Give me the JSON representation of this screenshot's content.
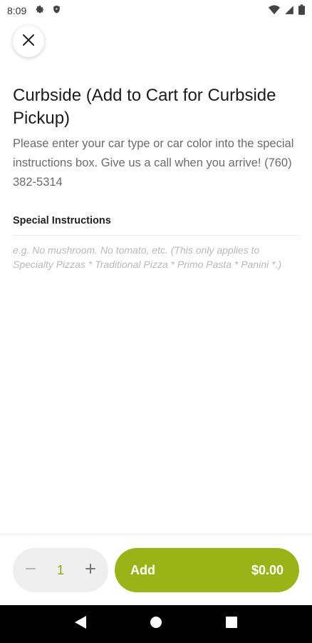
{
  "status_bar": {
    "time": "8:09",
    "icons": [
      "gear-icon",
      "shield-icon",
      "wifi-icon",
      "signal-icon",
      "battery-icon"
    ]
  },
  "close_button": {
    "icon": "close-icon"
  },
  "item": {
    "title": "Curbside (Add to Cart for Curbside Pickup)",
    "description": "Please enter your car type or car color into the special instructions box. Give us a call when you arrive! (760) 382-5314"
  },
  "special_instructions": {
    "label": "Special Instructions",
    "value": "",
    "placeholder": "e.g. No mushroom. No tomato, etc. (This only applies to Specialty Pizzas * Traditional Pizza * Primo Pasta * Panini *.)"
  },
  "quantity": {
    "value": "1",
    "decrement_icon": "minus-icon",
    "increment_icon": "plus-icon"
  },
  "add_button": {
    "label": "Add",
    "price": "$0.00"
  },
  "nav_bar": {
    "icons": [
      "back-icon",
      "home-icon",
      "recents-icon"
    ]
  },
  "colors": {
    "accent": "#9ab317",
    "quantity_text": "#8ca800",
    "stepper_bg": "#efefef",
    "nav_bg": "#000000"
  }
}
